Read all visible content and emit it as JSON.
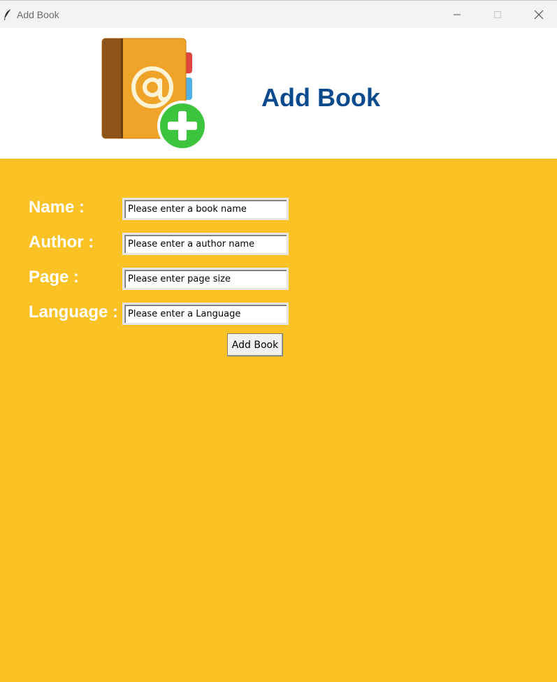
{
  "window": {
    "title": "Add Book",
    "icon": "feather-icon",
    "controls": [
      "minimize-icon",
      "maximize-icon",
      "close-icon"
    ]
  },
  "header": {
    "logo_icon": "address-book-add-icon",
    "title": "Add Book",
    "title_color": "#0b4a8c"
  },
  "form": {
    "background": "#fbc226",
    "fields": [
      {
        "label": "Name :",
        "value": "Please enter a book name"
      },
      {
        "label": "Author :",
        "value": "Please enter a author name"
      },
      {
        "label": "Page :",
        "value": "Please enter page size"
      },
      {
        "label": "Language :",
        "value": "Please enter a Language"
      }
    ],
    "submit_label": "Add Book"
  }
}
